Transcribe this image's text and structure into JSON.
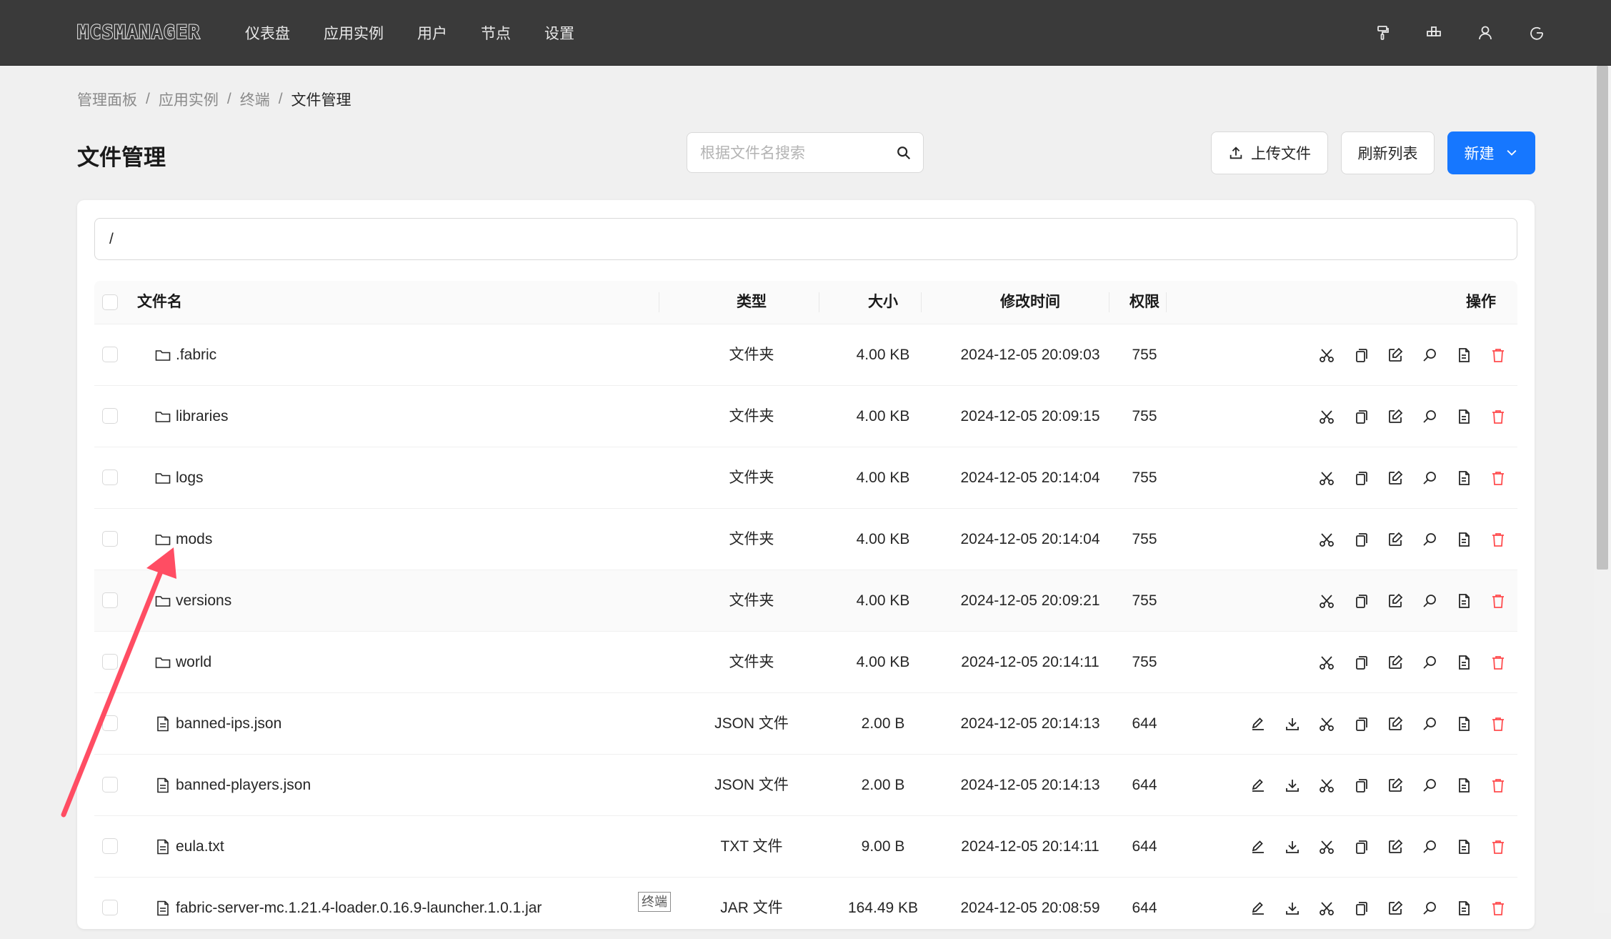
{
  "app": {
    "logo": "MCSMANAGER"
  },
  "nav": {
    "items": [
      "仪表盘",
      "应用实例",
      "用户",
      "节点",
      "设置"
    ]
  },
  "nav_icons": [
    "brush-icon",
    "layout-icon",
    "user-icon",
    "logout-icon"
  ],
  "breadcrumb": {
    "items": [
      "管理面板",
      "应用实例",
      "终端"
    ],
    "current": "文件管理",
    "separator": "/"
  },
  "page": {
    "title": "文件管理"
  },
  "search": {
    "placeholder": "根据文件名搜索",
    "value": ""
  },
  "toolbar": {
    "upload_label": "上传文件",
    "refresh_label": "刷新列表",
    "new_label": "新建"
  },
  "path": {
    "value": "/"
  },
  "table": {
    "headers": {
      "name": "文件名",
      "type": "类型",
      "size": "大小",
      "mtime": "修改时间",
      "perm": "权限",
      "actions": "操作"
    },
    "rows": [
      {
        "name": ".fabric",
        "type": "文件夹",
        "size": "4.00 KB",
        "mtime": "2024-12-05 20:09:03",
        "perm": "755",
        "kind": "folder"
      },
      {
        "name": "libraries",
        "type": "文件夹",
        "size": "4.00 KB",
        "mtime": "2024-12-05 20:09:15",
        "perm": "755",
        "kind": "folder"
      },
      {
        "name": "logs",
        "type": "文件夹",
        "size": "4.00 KB",
        "mtime": "2024-12-05 20:14:04",
        "perm": "755",
        "kind": "folder"
      },
      {
        "name": "mods",
        "type": "文件夹",
        "size": "4.00 KB",
        "mtime": "2024-12-05 20:14:04",
        "perm": "755",
        "kind": "folder"
      },
      {
        "name": "versions",
        "type": "文件夹",
        "size": "4.00 KB",
        "mtime": "2024-12-05 20:09:21",
        "perm": "755",
        "kind": "folder"
      },
      {
        "name": "world",
        "type": "文件夹",
        "size": "4.00 KB",
        "mtime": "2024-12-05 20:14:11",
        "perm": "755",
        "kind": "folder"
      },
      {
        "name": "banned-ips.json",
        "type": "JSON 文件",
        "size": "2.00 B",
        "mtime": "2024-12-05 20:14:13",
        "perm": "644",
        "kind": "file"
      },
      {
        "name": "banned-players.json",
        "type": "JSON 文件",
        "size": "2.00 B",
        "mtime": "2024-12-05 20:14:13",
        "perm": "644",
        "kind": "file"
      },
      {
        "name": "eula.txt",
        "type": "TXT 文件",
        "size": "9.00 B",
        "mtime": "2024-12-05 20:14:11",
        "perm": "644",
        "kind": "file"
      },
      {
        "name": "fabric-server-mc.1.21.4-loader.0.16.9-launcher.1.0.1.jar",
        "type": "JAR 文件",
        "size": "164.49 KB",
        "mtime": "2024-12-05 20:08:59",
        "perm": "644",
        "kind": "file"
      }
    ]
  },
  "tooltip": {
    "text": "终端"
  },
  "colors": {
    "navbar": "#3a3a3a",
    "primary": "#1677ff",
    "danger": "#ff4d4f",
    "annotation_arrow": "#ff4d63"
  }
}
